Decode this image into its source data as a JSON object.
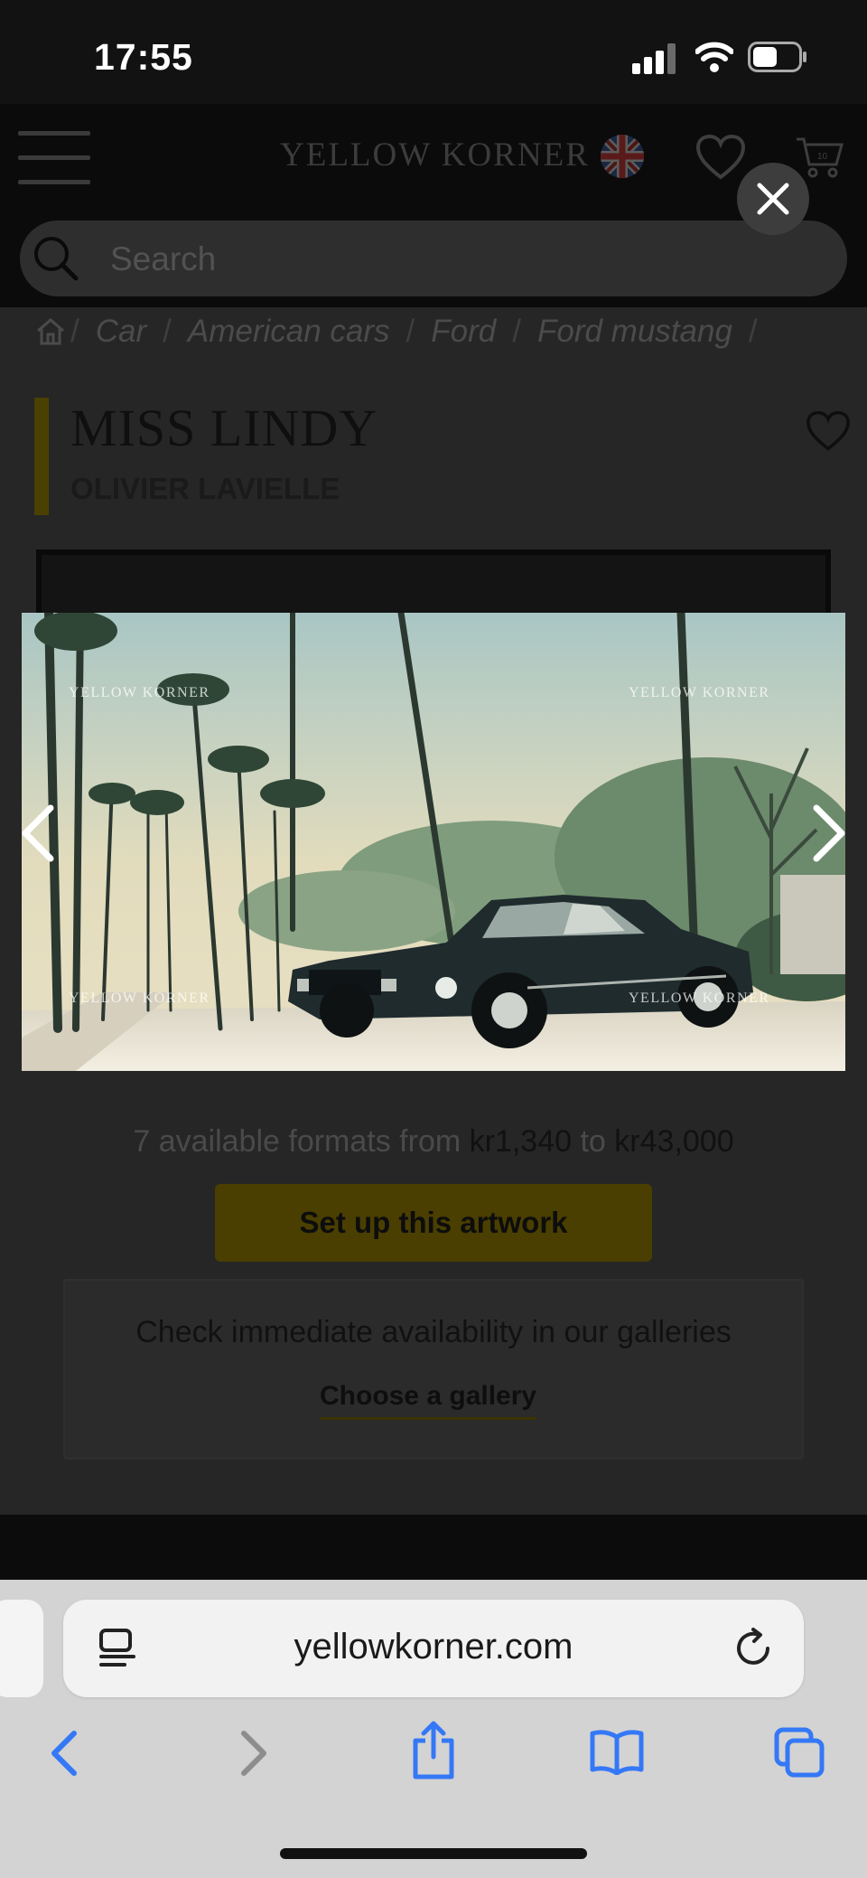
{
  "status_bar": {
    "time": "17:55"
  },
  "site_header": {
    "logo": "YELLOW KORNER",
    "search_placeholder": "Search",
    "cart_count": "10"
  },
  "breadcrumb": [
    "Car",
    "American cars",
    "Ford",
    "Ford mustang"
  ],
  "artwork": {
    "title": "MISS LINDY",
    "artist": "OLIVIER LAVIELLE"
  },
  "lightbox": {
    "watermark": "YELLOW KORNER"
  },
  "purchase": {
    "formats_prefix": "7 available formats from",
    "price_from": "kr1,340",
    "formats_mid": "to",
    "price_to": "kr43,000",
    "setup_label": "Set up this artwork"
  },
  "gallery": {
    "text": "Check immediate availability in our galleries",
    "link": "Choose a gallery"
  },
  "browser": {
    "url": "yellowkorner.com"
  },
  "colors": {
    "accent_yellow": "#4a3f00",
    "safari_blue": "#3478f6"
  }
}
